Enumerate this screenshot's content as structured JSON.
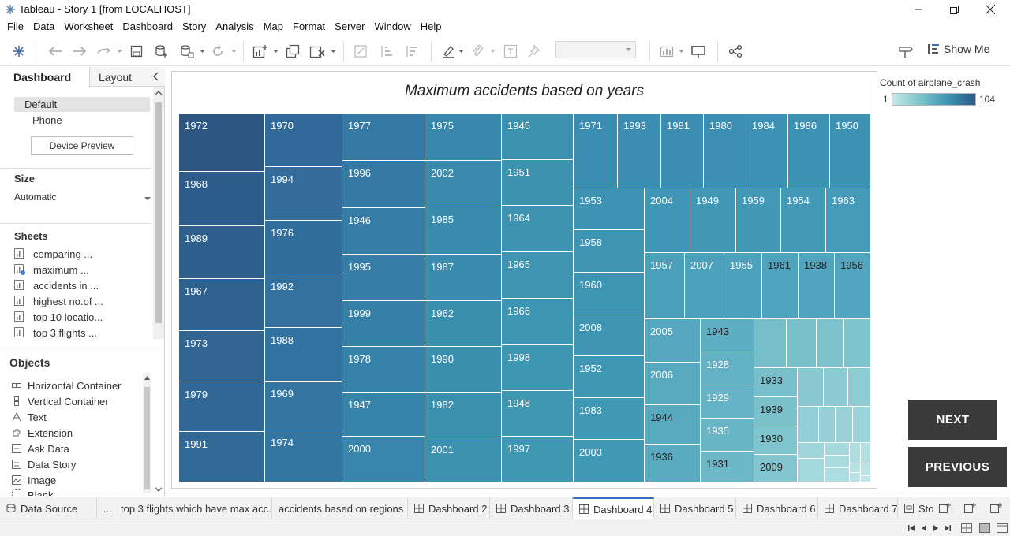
{
  "window": {
    "title": "Tableau - Story 1 [from LOCALHOST]"
  },
  "menu": [
    "File",
    "Data",
    "Worksheet",
    "Dashboard",
    "Story",
    "Analysis",
    "Map",
    "Format",
    "Server",
    "Window",
    "Help"
  ],
  "toolbar": {
    "show_me_label": "Show Me"
  },
  "left_panel": {
    "tabs": {
      "active": "Dashboard",
      "other": "Layout"
    },
    "device": {
      "default": "Default",
      "phone": "Phone",
      "preview_button": "Device Preview"
    },
    "size": {
      "title": "Size",
      "value": "Automatic"
    },
    "sheets": {
      "title": "Sheets",
      "items": [
        "comparing ...",
        "maximum ...",
        "accidents in ...",
        "highest no.of ...",
        "top 10 locatio...",
        "top 3 flights ..."
      ]
    },
    "objects": {
      "title": "Objects",
      "items": [
        "Horizontal Container",
        "Vertical Container",
        "Text",
        "Extension",
        "Ask Data",
        "Data Story",
        "Image",
        "Blank"
      ]
    }
  },
  "viz": {
    "title": "Maximum accidents based on years",
    "legend": {
      "title": "Count of airplane_crash",
      "min": "1",
      "max": "104"
    },
    "labels": [
      "1972",
      "1968",
      "1989",
      "1967",
      "1973",
      "1979",
      "1991",
      "1970",
      "1994",
      "1976",
      "1992",
      "1988",
      "1969",
      "1974",
      "1977",
      "1996",
      "1946",
      "1995",
      "1999",
      "1978",
      "1947",
      "2000",
      "1975",
      "2002",
      "1985",
      "1987",
      "1962",
      "1990",
      "1982",
      "2001",
      "1945",
      "1951",
      "1964",
      "1965",
      "1966",
      "1998",
      "1948",
      "1997",
      "1971",
      "1993",
      "1981",
      "1980",
      "1984",
      "1986",
      "1950",
      "1953",
      "1958",
      "1960",
      "2008",
      "1952",
      "1983",
      "2003",
      "2004",
      "1949",
      "1959",
      "1954",
      "1963",
      "1957",
      "2007",
      "1955",
      "1961",
      "1938",
      "1956",
      "2005",
      "2006",
      "1944",
      "1936",
      "1943",
      "1928",
      "1929",
      "1935",
      "1931",
      "1933",
      "1939",
      "1930",
      "2009"
    ]
  },
  "buttons": {
    "next": "NEXT",
    "previous": "PREVIOUS"
  },
  "bottom_tabs": [
    "Data Source",
    "...",
    "top 3 flights which have max acc...",
    "accidents based on regions",
    "Dashboard 2",
    "Dashboard 3",
    "Dashboard 4",
    "Dashboard 5",
    "Dashboard 6",
    "Dashboard 7",
    "Sto"
  ],
  "colors": {
    "accent": "#2f6ec0",
    "button_bg": "#3a3a3a",
    "scale_min": "#c7ebe8",
    "scale_max": "#2a5a88"
  }
}
